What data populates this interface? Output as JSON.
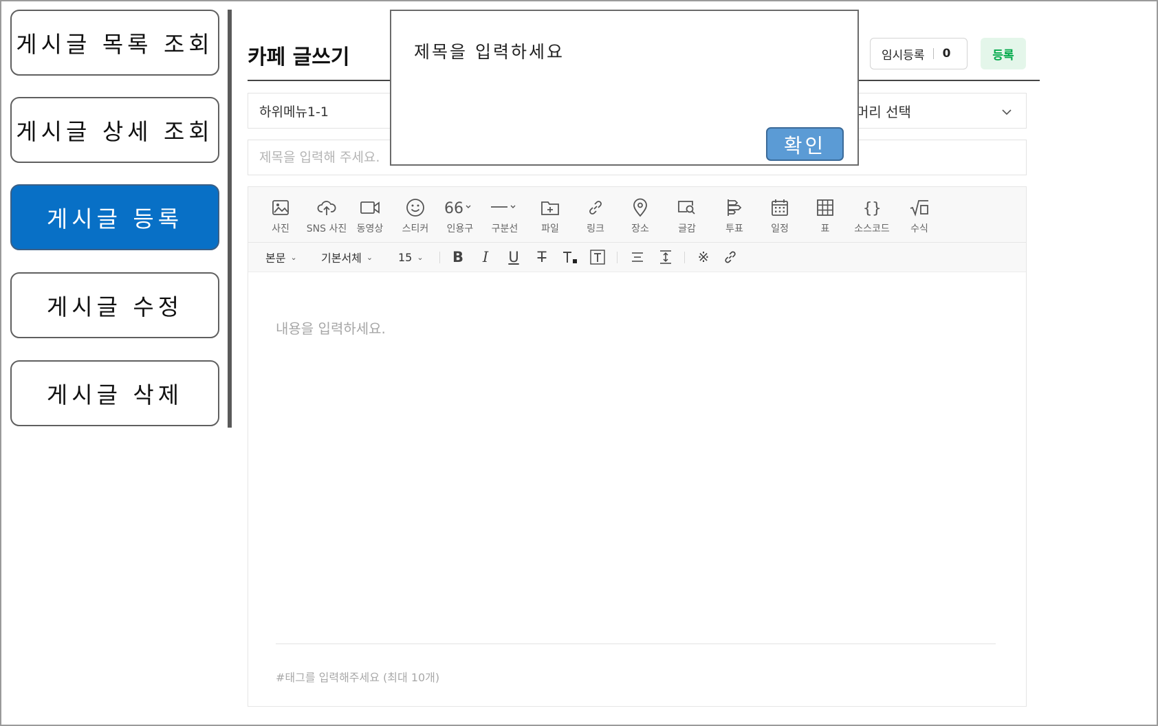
{
  "sidebar": {
    "items": [
      {
        "label": "게시글 목록 조회"
      },
      {
        "label": "게시글 상세 조회"
      },
      {
        "label": "게시글 등록"
      },
      {
        "label": "게시글 수정"
      },
      {
        "label": "게시글 삭제"
      }
    ],
    "active_index": 2
  },
  "header": {
    "title": "카페 글쓰기",
    "temp_save_label": "임시등록",
    "temp_save_count": "0",
    "publish_label": "등록"
  },
  "form": {
    "board_select_value": "하위메뉴1-1",
    "prefix_select_value": "머리 선택",
    "title_placeholder": "제목을 입력해 주세요."
  },
  "toolbar": {
    "items": [
      {
        "label": "사진",
        "icon": "image-icon"
      },
      {
        "label": "SNS 사진",
        "icon": "cloud-upload-icon"
      },
      {
        "label": "동영상",
        "icon": "video-icon"
      },
      {
        "label": "스티커",
        "icon": "smiley-icon"
      },
      {
        "label": "인용구",
        "icon": "quote-icon"
      },
      {
        "label": "구분선",
        "icon": "divider-icon"
      },
      {
        "label": "파일",
        "icon": "file-icon"
      },
      {
        "label": "링크",
        "icon": "link-icon"
      },
      {
        "label": "장소",
        "icon": "location-pin-icon"
      },
      {
        "label": "글감",
        "icon": "search-material-icon"
      },
      {
        "label": "투표",
        "icon": "vote-icon"
      },
      {
        "label": "일정",
        "icon": "calendar-icon"
      },
      {
        "label": "표",
        "icon": "table-icon"
      },
      {
        "label": "소스코드",
        "icon": "code-braces-icon"
      },
      {
        "label": "수식",
        "icon": "formula-icon"
      }
    ]
  },
  "format_bar": {
    "paragraph": "본문",
    "font": "기본서체",
    "size": "15"
  },
  "editor": {
    "body_placeholder": "내용을 입력하세요.",
    "tag_placeholder": "#태그를 입력해주세요 (최대 10개)"
  },
  "dialog": {
    "message": "제목을 입력하세요",
    "ok_label": "확인"
  }
}
